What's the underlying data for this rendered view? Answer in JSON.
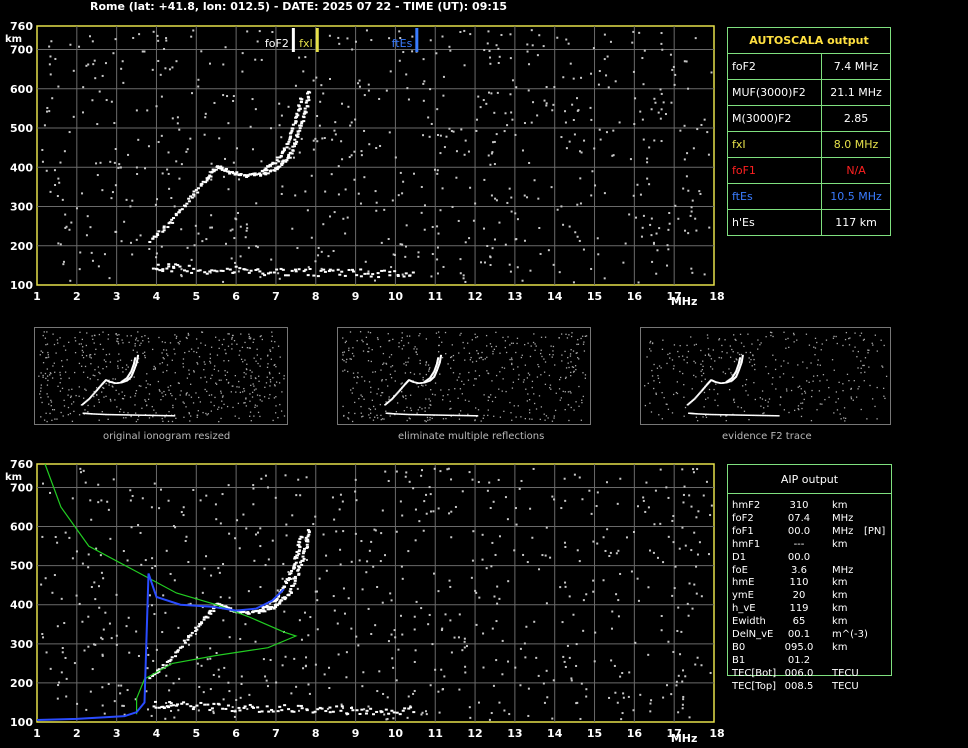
{
  "header": "Rome (lat: +41.8, lon: 012.5) - DATE: 2025 07 22 - TIME (UT): 09:15",
  "axis": {
    "unit_y": "km",
    "unit_x": "MHz",
    "y_ticks": [
      "760",
      "700",
      "600",
      "500",
      "400",
      "300",
      "200",
      "100"
    ],
    "x_ticks": [
      "1",
      "2",
      "3",
      "4",
      "5",
      "6",
      "7",
      "8",
      "9",
      "10",
      "11",
      "12",
      "13",
      "14",
      "15",
      "16",
      "17",
      "18"
    ]
  },
  "markers": [
    {
      "label": "foF2",
      "freq": 7.4,
      "color": "#ffffff"
    },
    {
      "label": "fxI",
      "freq": 8.0,
      "color": "#e6e04a"
    },
    {
      "label": "ftEs",
      "freq": 10.5,
      "color": "#3a7cff"
    }
  ],
  "autoscala": {
    "title": "AUTOSCALA output",
    "rows": [
      {
        "label": "foF2",
        "value": "7.4 MHz",
        "color": "#ffffff"
      },
      {
        "label": "MUF(3000)F2",
        "value": "21.1 MHz",
        "color": "#ffffff"
      },
      {
        "label": "M(3000)F2",
        "value": "2.85",
        "color": "#ffffff"
      },
      {
        "label": "fxI",
        "value": "8.0 MHz",
        "color": "#e6e04a"
      },
      {
        "label": "foF1",
        "value": "N/A",
        "color": "#ff2020"
      },
      {
        "label": "ftEs",
        "value": "10.5 MHz",
        "color": "#3a7cff"
      },
      {
        "label": "h'Es",
        "value": "117    km",
        "color": "#ffffff"
      }
    ]
  },
  "thumb_captions": [
    "original ionogram resized",
    "eliminate multiple reflections",
    "evidence F2 trace"
  ],
  "aip": {
    "title": "AIP output",
    "rows": [
      {
        "param": "hmF2",
        "value": "310",
        "unit": "km",
        "note": ""
      },
      {
        "param": "foF2",
        "value": "07.4",
        "unit": "MHz",
        "note": ""
      },
      {
        "param": "foF1",
        "value": "00.0",
        "unit": "MHz",
        "note": "[PN]"
      },
      {
        "param": "hmF1",
        "value": "---",
        "unit": "km",
        "note": ""
      },
      {
        "param": "D1",
        "value": "00.0",
        "unit": "",
        "note": ""
      },
      {
        "param": "foE",
        "value": "3.6",
        "unit": "MHz",
        "note": ""
      },
      {
        "param": "hmE",
        "value": "110",
        "unit": "km",
        "note": ""
      },
      {
        "param": "ymE",
        "value": "20",
        "unit": "km",
        "note": ""
      },
      {
        "param": "h_vE",
        "value": "119",
        "unit": "km",
        "note": ""
      },
      {
        "param": "Ewidth",
        "value": "65",
        "unit": "km",
        "note": ""
      },
      {
        "param": "DelN_vE",
        "value": "00.1",
        "unit": "m^(-3)",
        "note": ""
      },
      {
        "param": "B0",
        "value": "095.0",
        "unit": "km",
        "note": ""
      },
      {
        "param": "B1",
        "value": "01.2",
        "unit": "",
        "note": ""
      },
      {
        "param": "TEC[Bot]",
        "value": "006.0",
        "unit": "TECU",
        "note": ""
      },
      {
        "param": "TEC[Top]",
        "value": "008.5",
        "unit": "TECU",
        "note": ""
      }
    ]
  },
  "chart_data": [
    {
      "type": "scatter",
      "xlabel": "MHz",
      "ylabel": "km",
      "xlim": [
        1,
        18
      ],
      "ylim": [
        100,
        760
      ],
      "grid": true,
      "series": [
        {
          "values": [
            [
              3.9,
              150
            ],
            [
              4.5,
              145
            ],
            [
              5.5,
              140
            ],
            [
              6.5,
              138
            ],
            [
              7.5,
              136
            ],
            [
              8.5,
              134
            ],
            [
              9.5,
              132
            ],
            [
              10.5,
              130
            ]
          ]
        },
        {
          "values": [
            [
              3.8,
              215
            ],
            [
              4.3,
              260
            ],
            [
              4.8,
              320
            ],
            [
              5.2,
              370
            ],
            [
              5.5,
              405
            ],
            [
              5.8,
              390
            ],
            [
              6.2,
              380
            ],
            [
              6.6,
              385
            ],
            [
              7.0,
              400
            ],
            [
              7.3,
              430
            ],
            [
              7.5,
              480
            ],
            [
              7.7,
              540
            ],
            [
              7.8,
              600
            ]
          ]
        },
        {
          "values": [
            [
              6.6,
              390
            ],
            [
              7.0,
              420
            ],
            [
              7.3,
              470
            ],
            [
              7.5,
              530
            ],
            [
              7.6,
              580
            ]
          ]
        }
      ]
    },
    {
      "type": "line",
      "xlabel": "MHz",
      "ylabel": "km",
      "xlim": [
        1,
        18
      ],
      "ylim": [
        100,
        760
      ],
      "grid": true,
      "series": [
        {
          "color": "#22cc22",
          "values": [
            [
              1.2,
              760
            ],
            [
              1.6,
              650
            ],
            [
              2.3,
              550
            ],
            [
              3.4,
              490
            ],
            [
              4.5,
              430
            ],
            [
              5.5,
              400
            ],
            [
              6.3,
              370
            ],
            [
              7.2,
              330
            ],
            [
              7.5,
              320
            ],
            [
              6.8,
              290
            ],
            [
              5.5,
              270
            ],
            [
              4.4,
              250
            ],
            [
              3.7,
              210
            ],
            [
              3.5,
              160
            ],
            [
              3.5,
              120
            ]
          ]
        },
        {
          "color": "#2a4cff",
          "values": [
            [
              1.0,
              105
            ],
            [
              2.0,
              108
            ],
            [
              3.2,
              115
            ],
            [
              3.5,
              125
            ],
            [
              3.7,
              150
            ],
            [
              3.8,
              480
            ],
            [
              4.0,
              420
            ],
            [
              4.6,
              400
            ],
            [
              5.4,
              395
            ],
            [
              6.0,
              385
            ],
            [
              6.5,
              390
            ],
            [
              6.9,
              410
            ],
            [
              7.2,
              440
            ]
          ]
        }
      ]
    }
  ]
}
